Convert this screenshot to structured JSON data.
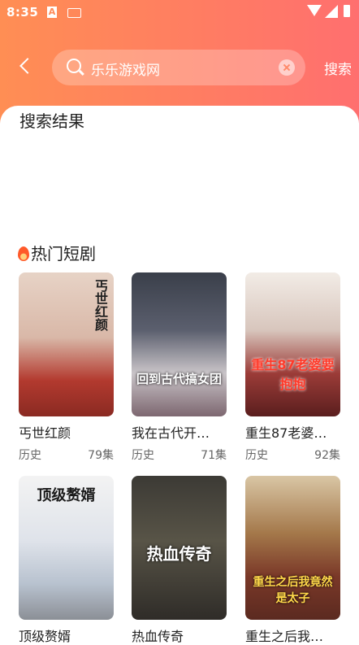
{
  "status_bar": {
    "time": "8:35",
    "a_badge": "A"
  },
  "search": {
    "query": "乐乐游戏网",
    "button_label": "搜索"
  },
  "results": {
    "title": "搜索结果"
  },
  "hot": {
    "title": "热门短剧",
    "items": [
      {
        "title": "丐世红颜",
        "genre": "历史",
        "episodes": "79集",
        "poster_text": "丐世红颜"
      },
      {
        "title": "我在古代开…",
        "genre": "历史",
        "episodes": "71集",
        "poster_text": "回到古代搞女团"
      },
      {
        "title": "重生87老婆…",
        "genre": "历史",
        "episodes": "92集",
        "poster_text": "重生87老婆要抱抱"
      },
      {
        "title": "顶级赘婿",
        "genre": "",
        "episodes": "",
        "poster_text": "顶级赘婿"
      },
      {
        "title": "热血传奇",
        "genre": "",
        "episodes": "",
        "poster_text": "热血传奇"
      },
      {
        "title": "重生之后我…",
        "genre": "",
        "episodes": "",
        "poster_text": "重生之后我竟然是太子"
      }
    ]
  }
}
